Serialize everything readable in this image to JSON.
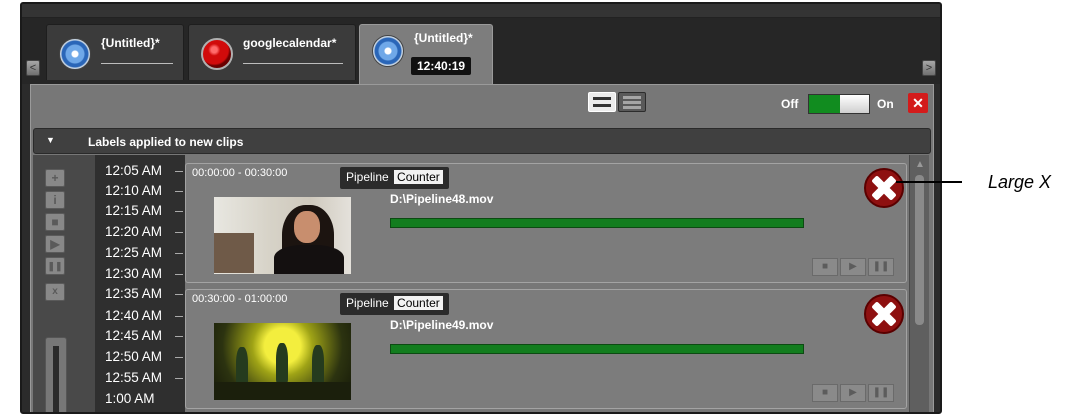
{
  "tabs": [
    {
      "title": "{Untitled}*",
      "icon": "blue-circle-icon"
    },
    {
      "title": "googlecalendar*",
      "icon": "red-record-icon"
    },
    {
      "title": "{Untitled}*",
      "icon": "blue-circle-icon",
      "time": "12:40:19",
      "active": true
    }
  ],
  "toolbar": {
    "off_label": "Off",
    "on_label": "On",
    "close_label": "✕"
  },
  "labels_bar": {
    "label": "Labels applied to new clips"
  },
  "side_buttons": [
    "+",
    "i",
    "■",
    "▶",
    "❚❚",
    "x"
  ],
  "times": [
    "12:05 AM",
    "12:10 AM",
    "12:15 AM",
    "12:20 AM",
    "12:25 AM",
    "12:30 AM",
    "12:35 AM",
    "12:40 AM",
    "12:45 AM",
    "12:50 AM",
    "12:55 AM",
    "1:00 AM"
  ],
  "clips": [
    {
      "range": "00:00:00  -  00:30:00",
      "tag": "Pipeline",
      "counter": "Counter",
      "path": "D:\\Pipeline48.mov"
    },
    {
      "range": "00:30:00  -  01:00:00",
      "tag": "Pipeline",
      "counter": "Counter",
      "path": "D:\\Pipeline49.mov"
    }
  ],
  "clip_controls": [
    "■",
    "▶",
    "❚❚"
  ],
  "annotation": {
    "label": "Large X"
  }
}
